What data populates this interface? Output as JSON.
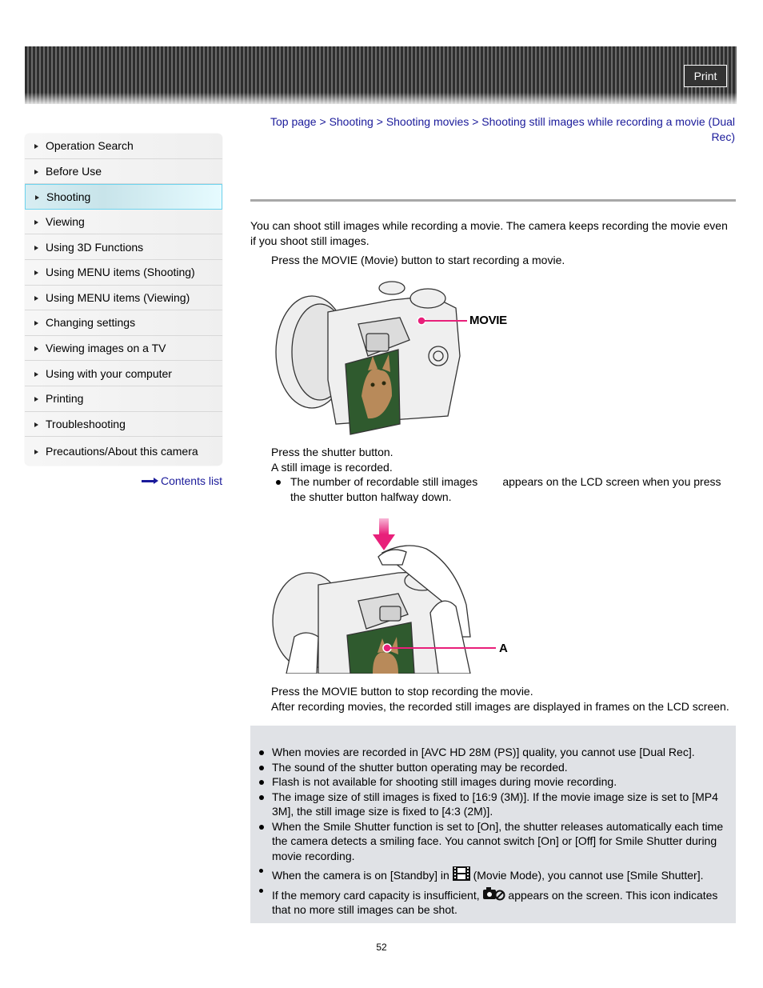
{
  "header": {
    "print_label": "Print"
  },
  "sidebar": {
    "items": [
      {
        "label": "Operation Search",
        "active": false
      },
      {
        "label": "Before Use",
        "active": false
      },
      {
        "label": "Shooting",
        "active": true
      },
      {
        "label": "Viewing",
        "active": false
      },
      {
        "label": "Using 3D Functions",
        "active": false
      },
      {
        "label": "Using MENU items (Shooting)",
        "active": false
      },
      {
        "label": "Using MENU items (Viewing)",
        "active": false
      },
      {
        "label": "Changing settings",
        "active": false
      },
      {
        "label": "Viewing images on a TV",
        "active": false
      },
      {
        "label": "Using with your computer",
        "active": false
      },
      {
        "label": "Printing",
        "active": false
      },
      {
        "label": "Troubleshooting",
        "active": false
      },
      {
        "label": "Precautions/About this camera",
        "active": false
      }
    ],
    "contents_link": "Contents list"
  },
  "breadcrumb": {
    "items": [
      "Top page",
      "Shooting",
      "Shooting movies",
      "Shooting still images while recording a movie (Dual Rec)"
    ],
    "separator": ">"
  },
  "content": {
    "intro": "You can shoot still images while recording a movie. The camera keeps recording the movie even if you shoot still images.",
    "step1": "Press the MOVIE (Movie) button to start recording a movie.",
    "figure1_label": "MOVIE",
    "step2": "Press the shutter button.",
    "step2_sub": "A still image is recorded.",
    "step2_bullet": "The number of recordable still images        appears on the LCD screen when you press the shutter button halfway down.",
    "figure2_label": "A",
    "step3": "Press the MOVIE button to stop recording the movie.",
    "step3_sub": "After recording movies, the recorded still images are displayed in frames on the LCD screen."
  },
  "notes": {
    "items": [
      "When movies are recorded in [AVC HD 28M (PS)] quality, you cannot use [Dual Rec].",
      "The sound of the shutter button operating may be recorded.",
      "Flash is not available for shooting still images during movie recording.",
      "The image size of still images is fixed to [16:9 (3M)]. If the movie image size is set to [MP4 3M], the still image size is fixed to [4:3 (2M)].",
      "When the Smile Shutter function is set to [On], the shutter releases automatically each time the camera detects a smiling face. You cannot switch [On] or [Off] for Smile Shutter during movie recording."
    ],
    "standby_before": "When the camera is on [Standby] in",
    "standby_after": "(Movie Mode), you cannot use [Smile Shutter].",
    "memory_before": "If the memory card capacity is insufficient,",
    "memory_after": "appears on the screen. This icon indicates that no more still images can be shot."
  },
  "footer": {
    "page_number": "52"
  },
  "colors": {
    "link": "#1a1a9a",
    "accent_pink": "#e8207a",
    "active_border": "#6ed3ee",
    "notes_bg": "#e0e2e6"
  }
}
